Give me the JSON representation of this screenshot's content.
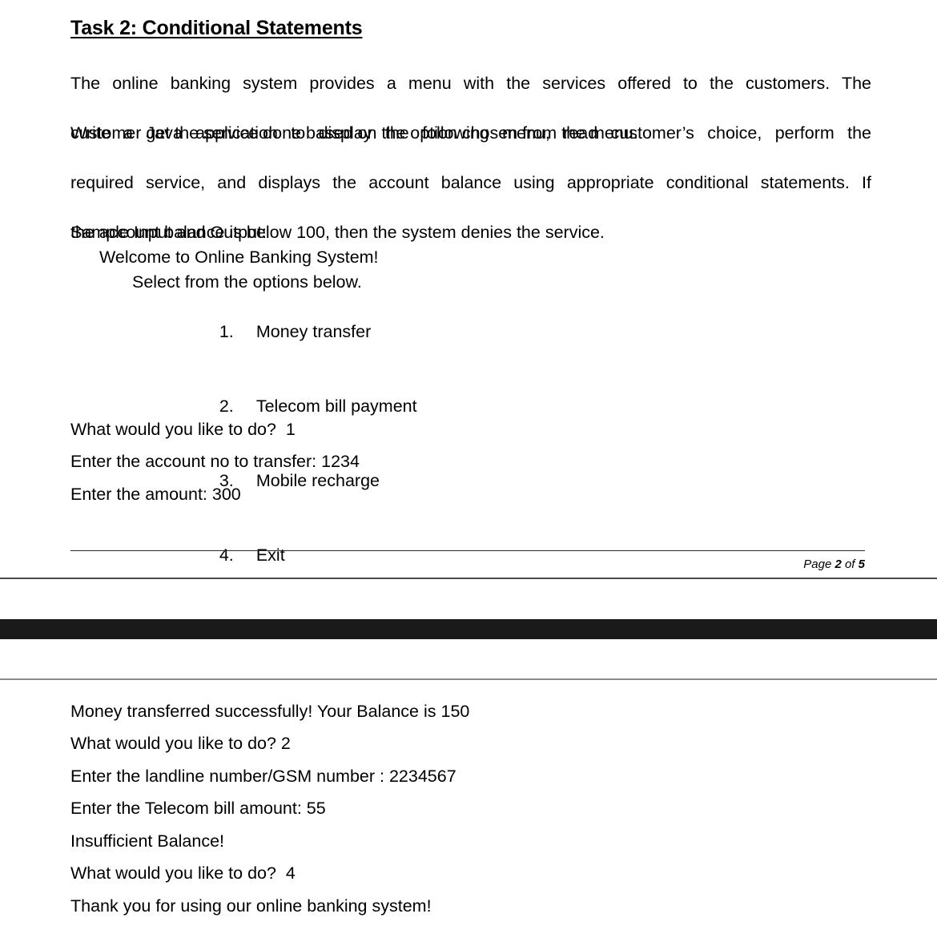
{
  "document": {
    "title": "Task 2: Conditional Statements",
    "intro": {
      "paragraph_1_lines": [
        "The online banking system provides a menu with the services offered to the customers. The",
        "customer get the service done based on the option chosen from the menu."
      ],
      "paragraph_2_lines": [
        "Write a Java application to display the following menu, read customer’s choice, perform the",
        "required service, and displays the account balance using appropriate conditional statements. If",
        "the account balance is below 100, then the system denies the service."
      ]
    },
    "sample": {
      "label": "Sample Input and Output:",
      "welcome": "Welcome to Online Banking System!",
      "select_prompt": "Select from the options below.",
      "menu_options": [
        {
          "number": "1.",
          "label": "Money transfer"
        },
        {
          "number": "2.",
          "label": "Telecom bill payment"
        },
        {
          "number": "3.",
          "label": "Mobile recharge"
        },
        {
          "number": "4.",
          "label": "Exit"
        }
      ],
      "session_page1": [
        "What would you like to do?  1",
        "Enter the account no to transfer: 1234",
        "Enter the amount: 300"
      ],
      "session_page2": [
        "Money transferred successfully! Your Balance is 150",
        "What would you like to do? 2",
        "Enter the landline number/GSM number : 2234567",
        "Enter the Telecom bill amount: 55",
        "Insufficient Balance!",
        "What would you like to do?  4",
        "Thank you for using our online banking system!"
      ]
    },
    "footer": {
      "page_prefix": "Page ",
      "page_current": "2",
      "page_middle": " of ",
      "page_total": "5"
    }
  },
  "colors": {
    "text": "#000000",
    "band": "#1a1a1a",
    "rule_top": "#4a4a4a",
    "rule_bottom": "#8a8a8a",
    "footer_rule": "#2b2b2b"
  }
}
